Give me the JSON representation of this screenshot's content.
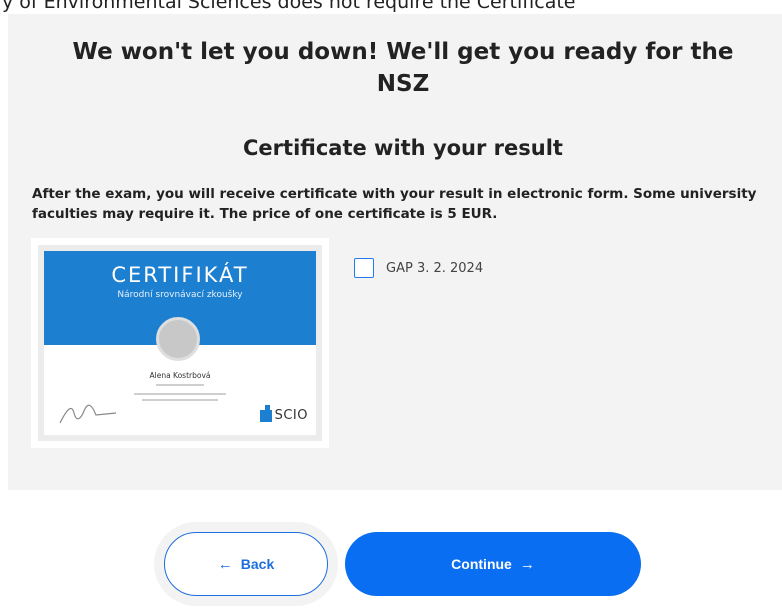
{
  "top_strip": {
    "text": "y of Environmental Sciences does not require the Certificate"
  },
  "headline": {
    "line1": "We won't let you down! We'll get you ready for the",
    "line2": "NSZ"
  },
  "section": {
    "title": "Certificate with your result",
    "description": "After the exam, you will receive certificate with your result in electronic form. Some university faculties may require it. The price of one certificate is 5 EUR."
  },
  "certificate_image": {
    "title": "CERTIFIKÁT",
    "subtitle": "Národní srovnávací zkoušky",
    "name": "Alena Kostrbová",
    "logo_text": "SCIO",
    "brand_color": "#1d7fd0"
  },
  "options": [
    {
      "label": "GAP 3. 2. 2024",
      "checked": false
    }
  ],
  "buttons": {
    "back": {
      "label": "Back",
      "icon": "arrow-left-icon"
    },
    "continue": {
      "label": "Continue",
      "icon": "arrow-right-icon"
    }
  },
  "colors": {
    "accent": "#0a6ef2",
    "panel": "#f3f3f4"
  }
}
